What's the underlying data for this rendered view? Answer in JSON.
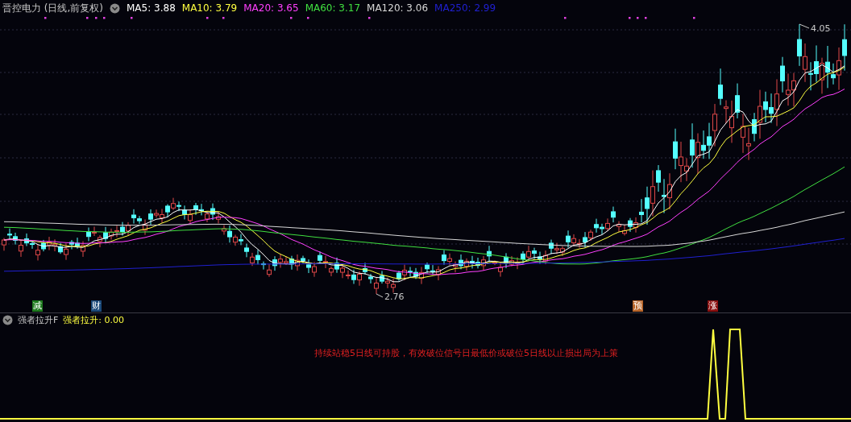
{
  "title": "晋控电力 (日线,前复权)",
  "ma_legend": [
    {
      "text": "MA5: 3.88",
      "color": "#ffffff"
    },
    {
      "text": "MA10: 3.79",
      "color": "#ffff40"
    },
    {
      "text": "MA20: 3.65",
      "color": "#ff40ff"
    },
    {
      "text": "MA60: 3.17",
      "color": "#40e040"
    },
    {
      "text": "MA120: 3.06",
      "color": "#d8d8d8"
    },
    {
      "text": "MA250: 2.99",
      "color": "#2020d0"
    }
  ],
  "high_label": "4.05",
  "low_label": "2.76",
  "signals": [
    {
      "text": "减",
      "color": "#1e7a1e"
    },
    {
      "text": "财",
      "color": "#1c4a7a"
    },
    {
      "text": "预",
      "color": "#b8652a"
    },
    {
      "text": "涨",
      "color": "#8a1010"
    }
  ],
  "indicator": {
    "name": "强者拉升F",
    "reading": "强者拉升: 0.00",
    "note": "持续站稳5日线可持股，有效破位信号日最低价或破位5日线以止损出局为上策"
  }
}
